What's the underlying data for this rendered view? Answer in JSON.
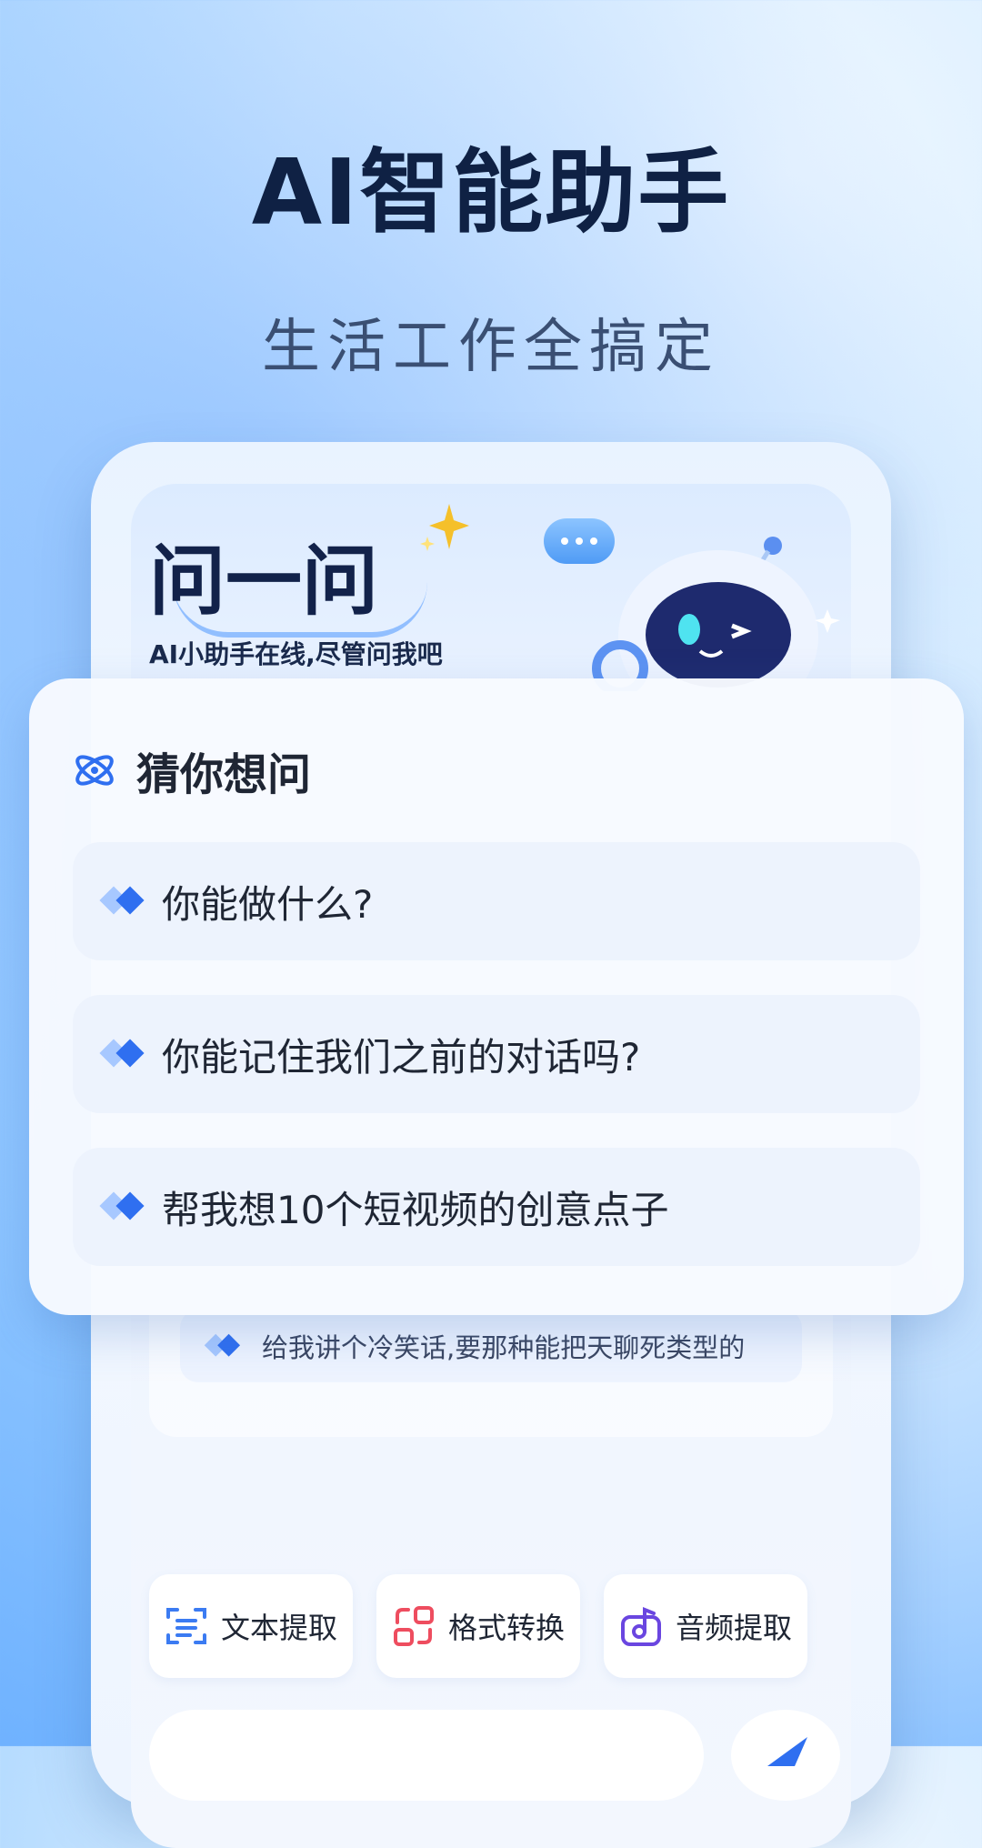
{
  "hero": {
    "title": "AI智能助手",
    "subtitle": "生活工作全搞定"
  },
  "ask_card": {
    "title": "问一问",
    "subtitle": "AI小助手在线,尽管问我吧"
  },
  "guess_panel": {
    "title": "猜你想问",
    "questions": [
      "你能做什么?",
      "你能记住我们之前的对话吗?",
      "帮我想10个短视频的创意点子"
    ],
    "hidden_question": "给我讲个冷笑话,要那种能把天聊死类型的"
  },
  "tools": [
    {
      "label": "文本提取",
      "icon": "text-extract-icon",
      "color": "#3b7bf2"
    },
    {
      "label": "格式转换",
      "icon": "format-convert-icon",
      "color": "#ee4d5f"
    },
    {
      "label": "音频提取",
      "icon": "audio-extract-icon",
      "color": "#6a46e0"
    }
  ],
  "colors": {
    "accent": "#2f6ff0",
    "title": "#0f2144"
  }
}
